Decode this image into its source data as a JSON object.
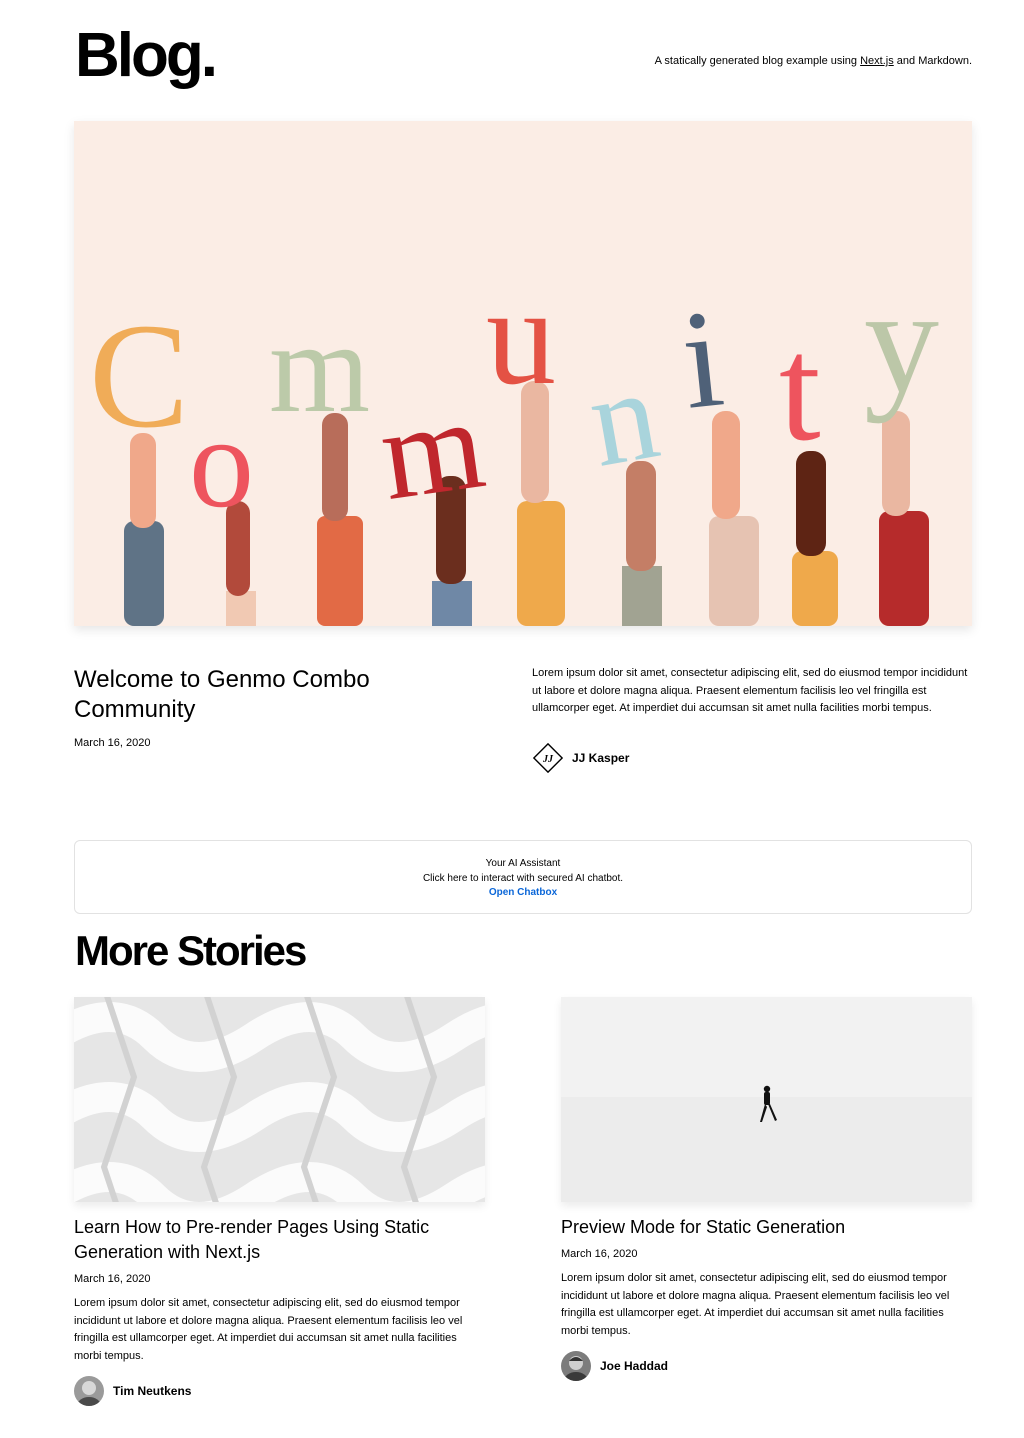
{
  "header": {
    "logo": "Blog.",
    "tagline_prefix": "A statically generated blog example using ",
    "tagline_link": "Next.js",
    "tagline_suffix": " and Markdown."
  },
  "hero": {
    "image_word": "Community",
    "title": "Welcome to Genmo Combo Community",
    "date": "March 16, 2020",
    "excerpt": "Lorem ipsum dolor sit amet, consectetur adipiscing elit, sed do eiusmod tempor incididunt ut labore et dolore magna aliqua. Praesent elementum facilisis leo vel fringilla est ullamcorper eget. At imperdiet dui accumsan sit amet nulla facilities morbi tempus.",
    "author": "JJ Kasper"
  },
  "ai_assistant": {
    "heading": "Your AI Assistant",
    "subtext": "Click here to interact with secured AI chatbot.",
    "link": "Open Chatbox"
  },
  "more_stories": {
    "heading": "More Stories",
    "posts": [
      {
        "title": "Learn How to Pre-render Pages Using Static Generation with Next.js",
        "date": "March 16, 2020",
        "excerpt": "Lorem ipsum dolor sit amet, consectetur adipiscing elit, sed do eiusmod tempor incididunt ut labore et dolore magna aliqua. Praesent elementum facilisis leo vel fringilla est ullamcorper eget. At imperdiet dui accumsan sit amet nulla facilities morbi tempus.",
        "author": "Tim Neutkens"
      },
      {
        "title": "Preview Mode for Static Generation",
        "date": "March 16, 2020",
        "excerpt": "Lorem ipsum dolor sit amet, consectetur adipiscing elit, sed do eiusmod tempor incididunt ut labore et dolore magna aliqua. Praesent elementum facilisis leo vel fringilla est ullamcorper eget. At imperdiet dui accumsan sit amet nulla facilities morbi tempus.",
        "author": "Joe Haddad"
      }
    ]
  }
}
